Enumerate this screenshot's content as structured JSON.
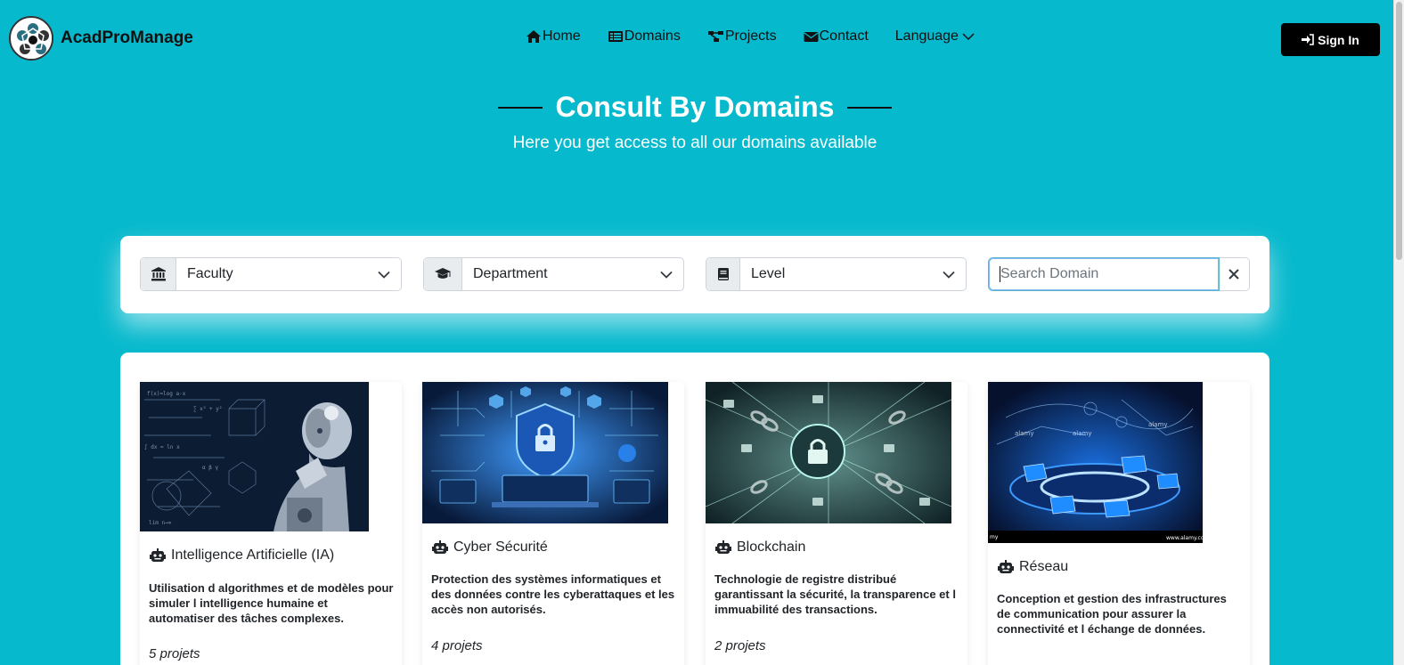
{
  "brand": {
    "name": "AcadProManage"
  },
  "nav": {
    "home": "Home",
    "domains": "Domains",
    "projects": "Projects",
    "contact": "Contact",
    "language": "Language",
    "signin": "Sign In"
  },
  "hero": {
    "title": "Consult By Domains",
    "subtitle": "Here you get access to all our domains available"
  },
  "filters": {
    "faculty": "Faculty",
    "department": "Department",
    "level": "Level",
    "search_placeholder": "Search Domain"
  },
  "domains": [
    {
      "name": "Intelligence Artificielle (IA)",
      "description": "Utilisation d algorithmes et de modèles pour simuler l intelligence humaine et automatiser des tâches complexes.",
      "count": "5 projets"
    },
    {
      "name": "Cyber Sécurité",
      "description": "Protection des systèmes informatiques et des données contre les cyberattaques et les accès non autorisés.",
      "count": "4 projets"
    },
    {
      "name": "Blockchain",
      "description": "Technologie de registre distribué garantissant la sécurité, la transparence et l immuabilité des transactions.",
      "count": "2 projets"
    },
    {
      "name": "Réseau",
      "description": "Conception et gestion des infrastructures de communication pour assurer la connectivité et l échange de données.",
      "count": ""
    }
  ],
  "colors": {
    "background": "#07b9cd",
    "signin_bg": "#000000",
    "panel": "#ffffff"
  },
  "icons": {
    "home": "home-icon",
    "domains": "list-icon",
    "projects": "sitemap-icon",
    "contact": "envelope-icon",
    "language": "chevron-down-icon",
    "signin": "sign-in-icon",
    "faculty": "building-columns-icon",
    "department": "graduation-cap-icon",
    "level": "book-icon",
    "clear": "close-icon",
    "domain": "robot-icon"
  }
}
